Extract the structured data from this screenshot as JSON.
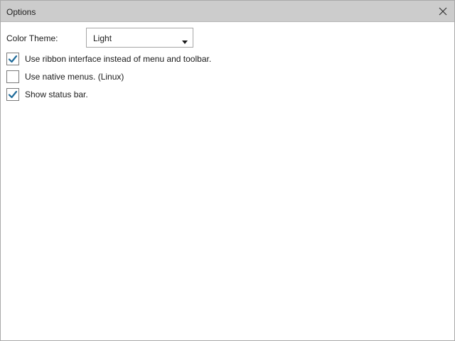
{
  "window": {
    "title": "Options"
  },
  "options": {
    "color_theme_label": "Color Theme:",
    "color_theme_value": "Light",
    "checkboxes": [
      {
        "label": "Use ribbon interface instead of menu and toolbar.",
        "checked": true
      },
      {
        "label": "Use native menus. (Linux)",
        "checked": false
      },
      {
        "label": "Show status bar.",
        "checked": true
      }
    ]
  },
  "colors": {
    "titlebar": "#cccccc",
    "check_accent": "#1f6b9a",
    "border": "#a9a9a9"
  },
  "icons": {
    "close": "close-icon",
    "dropdown": "chevron-down-icon",
    "check": "check-icon"
  }
}
